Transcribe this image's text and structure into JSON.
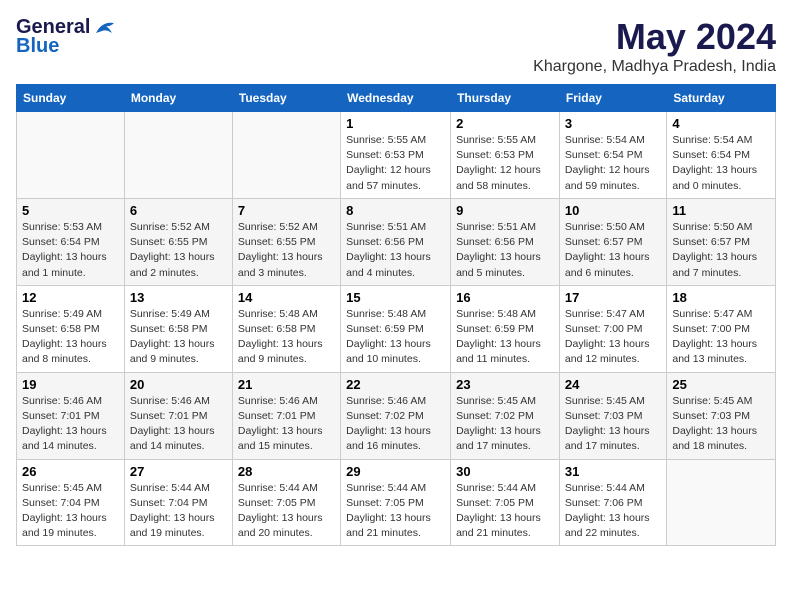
{
  "header": {
    "logo_general": "General",
    "logo_blue": "Blue",
    "month_year": "May 2024",
    "location": "Khargone, Madhya Pradesh, India"
  },
  "days_of_week": [
    "Sunday",
    "Monday",
    "Tuesday",
    "Wednesday",
    "Thursday",
    "Friday",
    "Saturday"
  ],
  "weeks": [
    [
      {
        "day": "",
        "sunrise": "",
        "sunset": "",
        "daylight": ""
      },
      {
        "day": "",
        "sunrise": "",
        "sunset": "",
        "daylight": ""
      },
      {
        "day": "",
        "sunrise": "",
        "sunset": "",
        "daylight": ""
      },
      {
        "day": "1",
        "sunrise": "Sunrise: 5:55 AM",
        "sunset": "Sunset: 6:53 PM",
        "daylight": "Daylight: 12 hours and 57 minutes."
      },
      {
        "day": "2",
        "sunrise": "Sunrise: 5:55 AM",
        "sunset": "Sunset: 6:53 PM",
        "daylight": "Daylight: 12 hours and 58 minutes."
      },
      {
        "day": "3",
        "sunrise": "Sunrise: 5:54 AM",
        "sunset": "Sunset: 6:54 PM",
        "daylight": "Daylight: 12 hours and 59 minutes."
      },
      {
        "day": "4",
        "sunrise": "Sunrise: 5:54 AM",
        "sunset": "Sunset: 6:54 PM",
        "daylight": "Daylight: 13 hours and 0 minutes."
      }
    ],
    [
      {
        "day": "5",
        "sunrise": "Sunrise: 5:53 AM",
        "sunset": "Sunset: 6:54 PM",
        "daylight": "Daylight: 13 hours and 1 minute."
      },
      {
        "day": "6",
        "sunrise": "Sunrise: 5:52 AM",
        "sunset": "Sunset: 6:55 PM",
        "daylight": "Daylight: 13 hours and 2 minutes."
      },
      {
        "day": "7",
        "sunrise": "Sunrise: 5:52 AM",
        "sunset": "Sunset: 6:55 PM",
        "daylight": "Daylight: 13 hours and 3 minutes."
      },
      {
        "day": "8",
        "sunrise": "Sunrise: 5:51 AM",
        "sunset": "Sunset: 6:56 PM",
        "daylight": "Daylight: 13 hours and 4 minutes."
      },
      {
        "day": "9",
        "sunrise": "Sunrise: 5:51 AM",
        "sunset": "Sunset: 6:56 PM",
        "daylight": "Daylight: 13 hours and 5 minutes."
      },
      {
        "day": "10",
        "sunrise": "Sunrise: 5:50 AM",
        "sunset": "Sunset: 6:57 PM",
        "daylight": "Daylight: 13 hours and 6 minutes."
      },
      {
        "day": "11",
        "sunrise": "Sunrise: 5:50 AM",
        "sunset": "Sunset: 6:57 PM",
        "daylight": "Daylight: 13 hours and 7 minutes."
      }
    ],
    [
      {
        "day": "12",
        "sunrise": "Sunrise: 5:49 AM",
        "sunset": "Sunset: 6:58 PM",
        "daylight": "Daylight: 13 hours and 8 minutes."
      },
      {
        "day": "13",
        "sunrise": "Sunrise: 5:49 AM",
        "sunset": "Sunset: 6:58 PM",
        "daylight": "Daylight: 13 hours and 9 minutes."
      },
      {
        "day": "14",
        "sunrise": "Sunrise: 5:48 AM",
        "sunset": "Sunset: 6:58 PM",
        "daylight": "Daylight: 13 hours and 9 minutes."
      },
      {
        "day": "15",
        "sunrise": "Sunrise: 5:48 AM",
        "sunset": "Sunset: 6:59 PM",
        "daylight": "Daylight: 13 hours and 10 minutes."
      },
      {
        "day": "16",
        "sunrise": "Sunrise: 5:48 AM",
        "sunset": "Sunset: 6:59 PM",
        "daylight": "Daylight: 13 hours and 11 minutes."
      },
      {
        "day": "17",
        "sunrise": "Sunrise: 5:47 AM",
        "sunset": "Sunset: 7:00 PM",
        "daylight": "Daylight: 13 hours and 12 minutes."
      },
      {
        "day": "18",
        "sunrise": "Sunrise: 5:47 AM",
        "sunset": "Sunset: 7:00 PM",
        "daylight": "Daylight: 13 hours and 13 minutes."
      }
    ],
    [
      {
        "day": "19",
        "sunrise": "Sunrise: 5:46 AM",
        "sunset": "Sunset: 7:01 PM",
        "daylight": "Daylight: 13 hours and 14 minutes."
      },
      {
        "day": "20",
        "sunrise": "Sunrise: 5:46 AM",
        "sunset": "Sunset: 7:01 PM",
        "daylight": "Daylight: 13 hours and 14 minutes."
      },
      {
        "day": "21",
        "sunrise": "Sunrise: 5:46 AM",
        "sunset": "Sunset: 7:01 PM",
        "daylight": "Daylight: 13 hours and 15 minutes."
      },
      {
        "day": "22",
        "sunrise": "Sunrise: 5:46 AM",
        "sunset": "Sunset: 7:02 PM",
        "daylight": "Daylight: 13 hours and 16 minutes."
      },
      {
        "day": "23",
        "sunrise": "Sunrise: 5:45 AM",
        "sunset": "Sunset: 7:02 PM",
        "daylight": "Daylight: 13 hours and 17 minutes."
      },
      {
        "day": "24",
        "sunrise": "Sunrise: 5:45 AM",
        "sunset": "Sunset: 7:03 PM",
        "daylight": "Daylight: 13 hours and 17 minutes."
      },
      {
        "day": "25",
        "sunrise": "Sunrise: 5:45 AM",
        "sunset": "Sunset: 7:03 PM",
        "daylight": "Daylight: 13 hours and 18 minutes."
      }
    ],
    [
      {
        "day": "26",
        "sunrise": "Sunrise: 5:45 AM",
        "sunset": "Sunset: 7:04 PM",
        "daylight": "Daylight: 13 hours and 19 minutes."
      },
      {
        "day": "27",
        "sunrise": "Sunrise: 5:44 AM",
        "sunset": "Sunset: 7:04 PM",
        "daylight": "Daylight: 13 hours and 19 minutes."
      },
      {
        "day": "28",
        "sunrise": "Sunrise: 5:44 AM",
        "sunset": "Sunset: 7:05 PM",
        "daylight": "Daylight: 13 hours and 20 minutes."
      },
      {
        "day": "29",
        "sunrise": "Sunrise: 5:44 AM",
        "sunset": "Sunset: 7:05 PM",
        "daylight": "Daylight: 13 hours and 21 minutes."
      },
      {
        "day": "30",
        "sunrise": "Sunrise: 5:44 AM",
        "sunset": "Sunset: 7:05 PM",
        "daylight": "Daylight: 13 hours and 21 minutes."
      },
      {
        "day": "31",
        "sunrise": "Sunrise: 5:44 AM",
        "sunset": "Sunset: 7:06 PM",
        "daylight": "Daylight: 13 hours and 22 minutes."
      },
      {
        "day": "",
        "sunrise": "",
        "sunset": "",
        "daylight": ""
      }
    ]
  ]
}
